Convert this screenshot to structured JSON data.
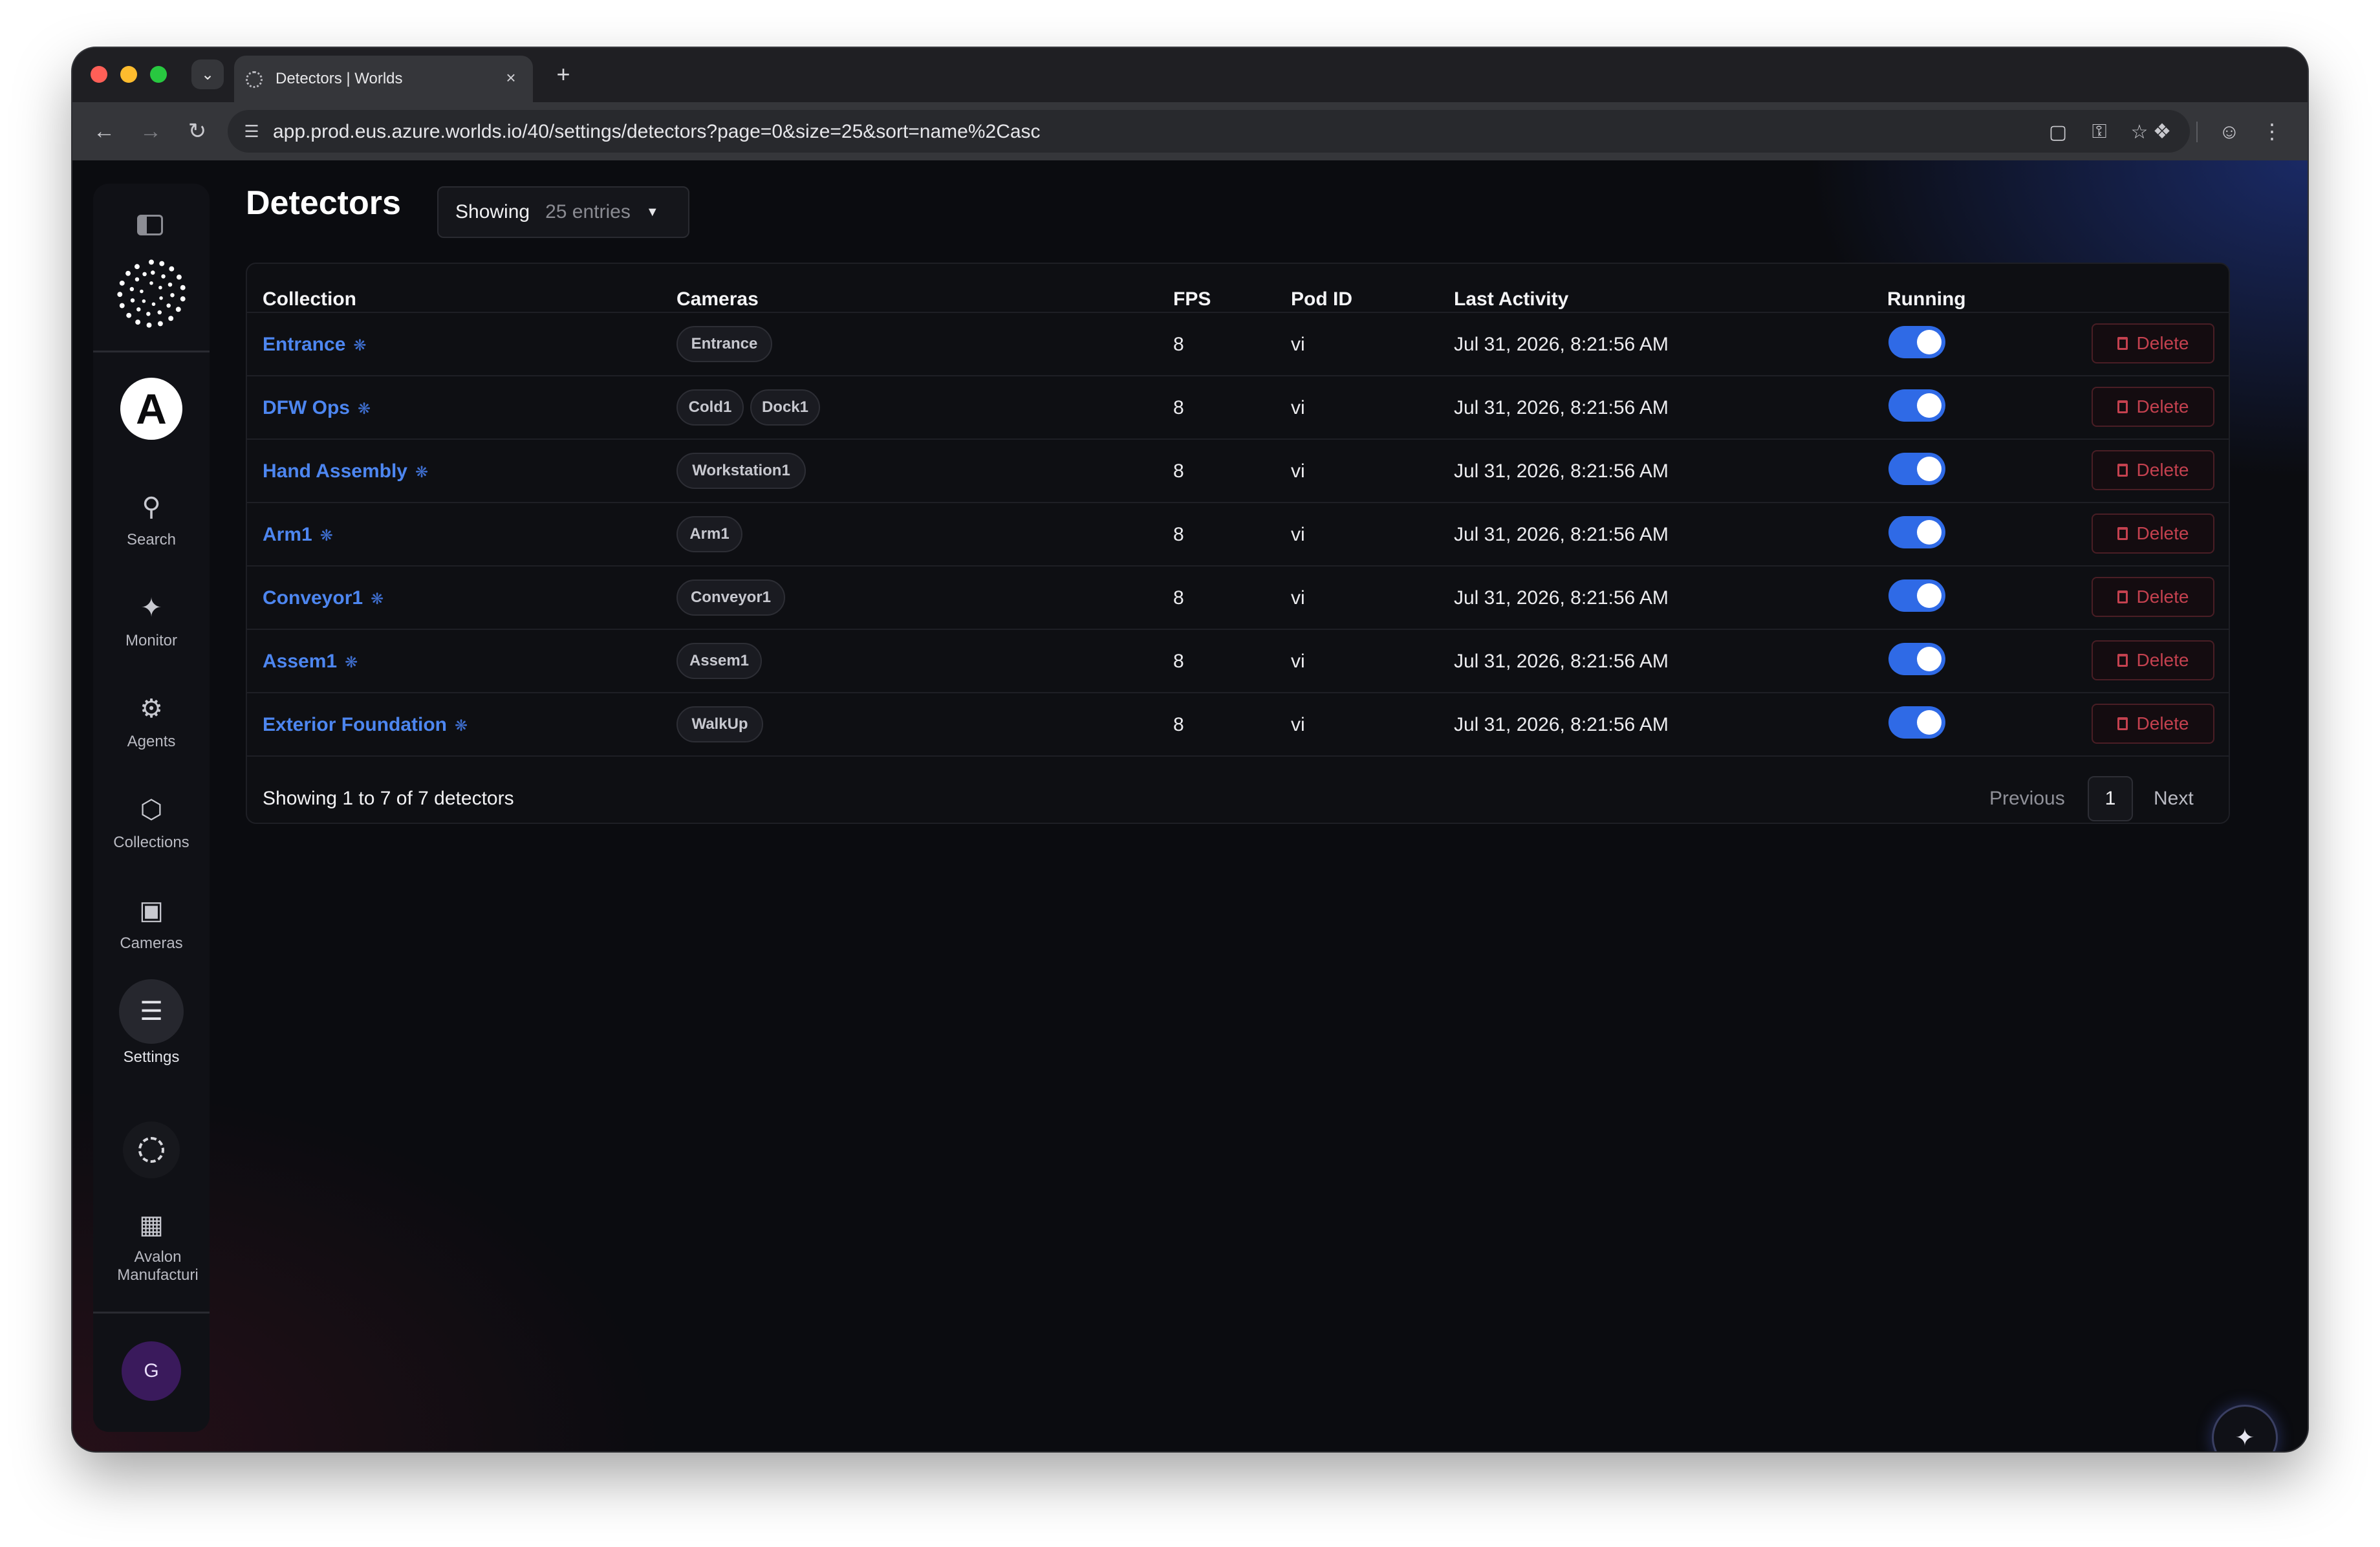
{
  "browser": {
    "tab_title": "Detectors | Worlds",
    "url": "app.prod.eus.azure.worlds.io/40/settings/detectors?page=0&size=25&sort=name%2Casc",
    "tab_dropdown_icon": "chevron-down-icon",
    "new_tab_label": "+",
    "close_tab_label": "×"
  },
  "sidebar": {
    "org_initial": "A",
    "nav": [
      {
        "label": "Search",
        "icon": "search-icon"
      },
      {
        "label": "Monitor",
        "icon": "monitor-icon"
      },
      {
        "label": "Agents",
        "icon": "robot-icon"
      },
      {
        "label": "Collections",
        "icon": "cube-icon"
      },
      {
        "label": "Cameras",
        "icon": "camera-icon"
      },
      {
        "label": "Settings",
        "icon": "sliders-icon",
        "active": true
      }
    ],
    "site_label": "Avalon Manufacturi",
    "user_initial": "G"
  },
  "header": {
    "title": "Detectors",
    "entries_label": "Showing",
    "entries_value": "25 entries"
  },
  "table": {
    "columns": [
      "Collection",
      "Cameras",
      "FPS",
      "Pod ID",
      "Last Activity",
      "Running"
    ],
    "delete_label": "Delete",
    "rows": [
      {
        "collection": "Entrance",
        "cameras": [
          "Entrance"
        ],
        "fps": "8",
        "pod_id": "vi",
        "last_activity": "Jul 31, 2026, 8:21:56 AM",
        "running": true
      },
      {
        "collection": "DFW Ops",
        "cameras": [
          "Cold1",
          "Dock1"
        ],
        "fps": "8",
        "pod_id": "vi",
        "last_activity": "Jul 31, 2026, 8:21:56 AM",
        "running": true
      },
      {
        "collection": "Hand Assembly",
        "cameras": [
          "Workstation1"
        ],
        "fps": "8",
        "pod_id": "vi",
        "last_activity": "Jul 31, 2026, 8:21:56 AM",
        "running": true
      },
      {
        "collection": "Arm1",
        "cameras": [
          "Arm1"
        ],
        "fps": "8",
        "pod_id": "vi",
        "last_activity": "Jul 31, 2026, 8:21:56 AM",
        "running": true
      },
      {
        "collection": "Conveyor1",
        "cameras": [
          "Conveyor1"
        ],
        "fps": "8",
        "pod_id": "vi",
        "last_activity": "Jul 31, 2026, 8:21:56 AM",
        "running": true
      },
      {
        "collection": "Assem1",
        "cameras": [
          "Assem1"
        ],
        "fps": "8",
        "pod_id": "vi",
        "last_activity": "Jul 31, 2026, 8:21:56 AM",
        "running": true
      },
      {
        "collection": "Exterior Foundation",
        "cameras": [
          "WalkUp"
        ],
        "fps": "8",
        "pod_id": "vi",
        "last_activity": "Jul 31, 2026, 8:21:56 AM",
        "running": true
      }
    ],
    "footer": "Showing 1 to 7 of 7 detectors",
    "pagination": {
      "previous": "Previous",
      "current_page": "1",
      "next": "Next"
    }
  },
  "colors": {
    "accent": "#2f6ae6",
    "link": "#4d86f0",
    "danger": "#c4414f"
  }
}
